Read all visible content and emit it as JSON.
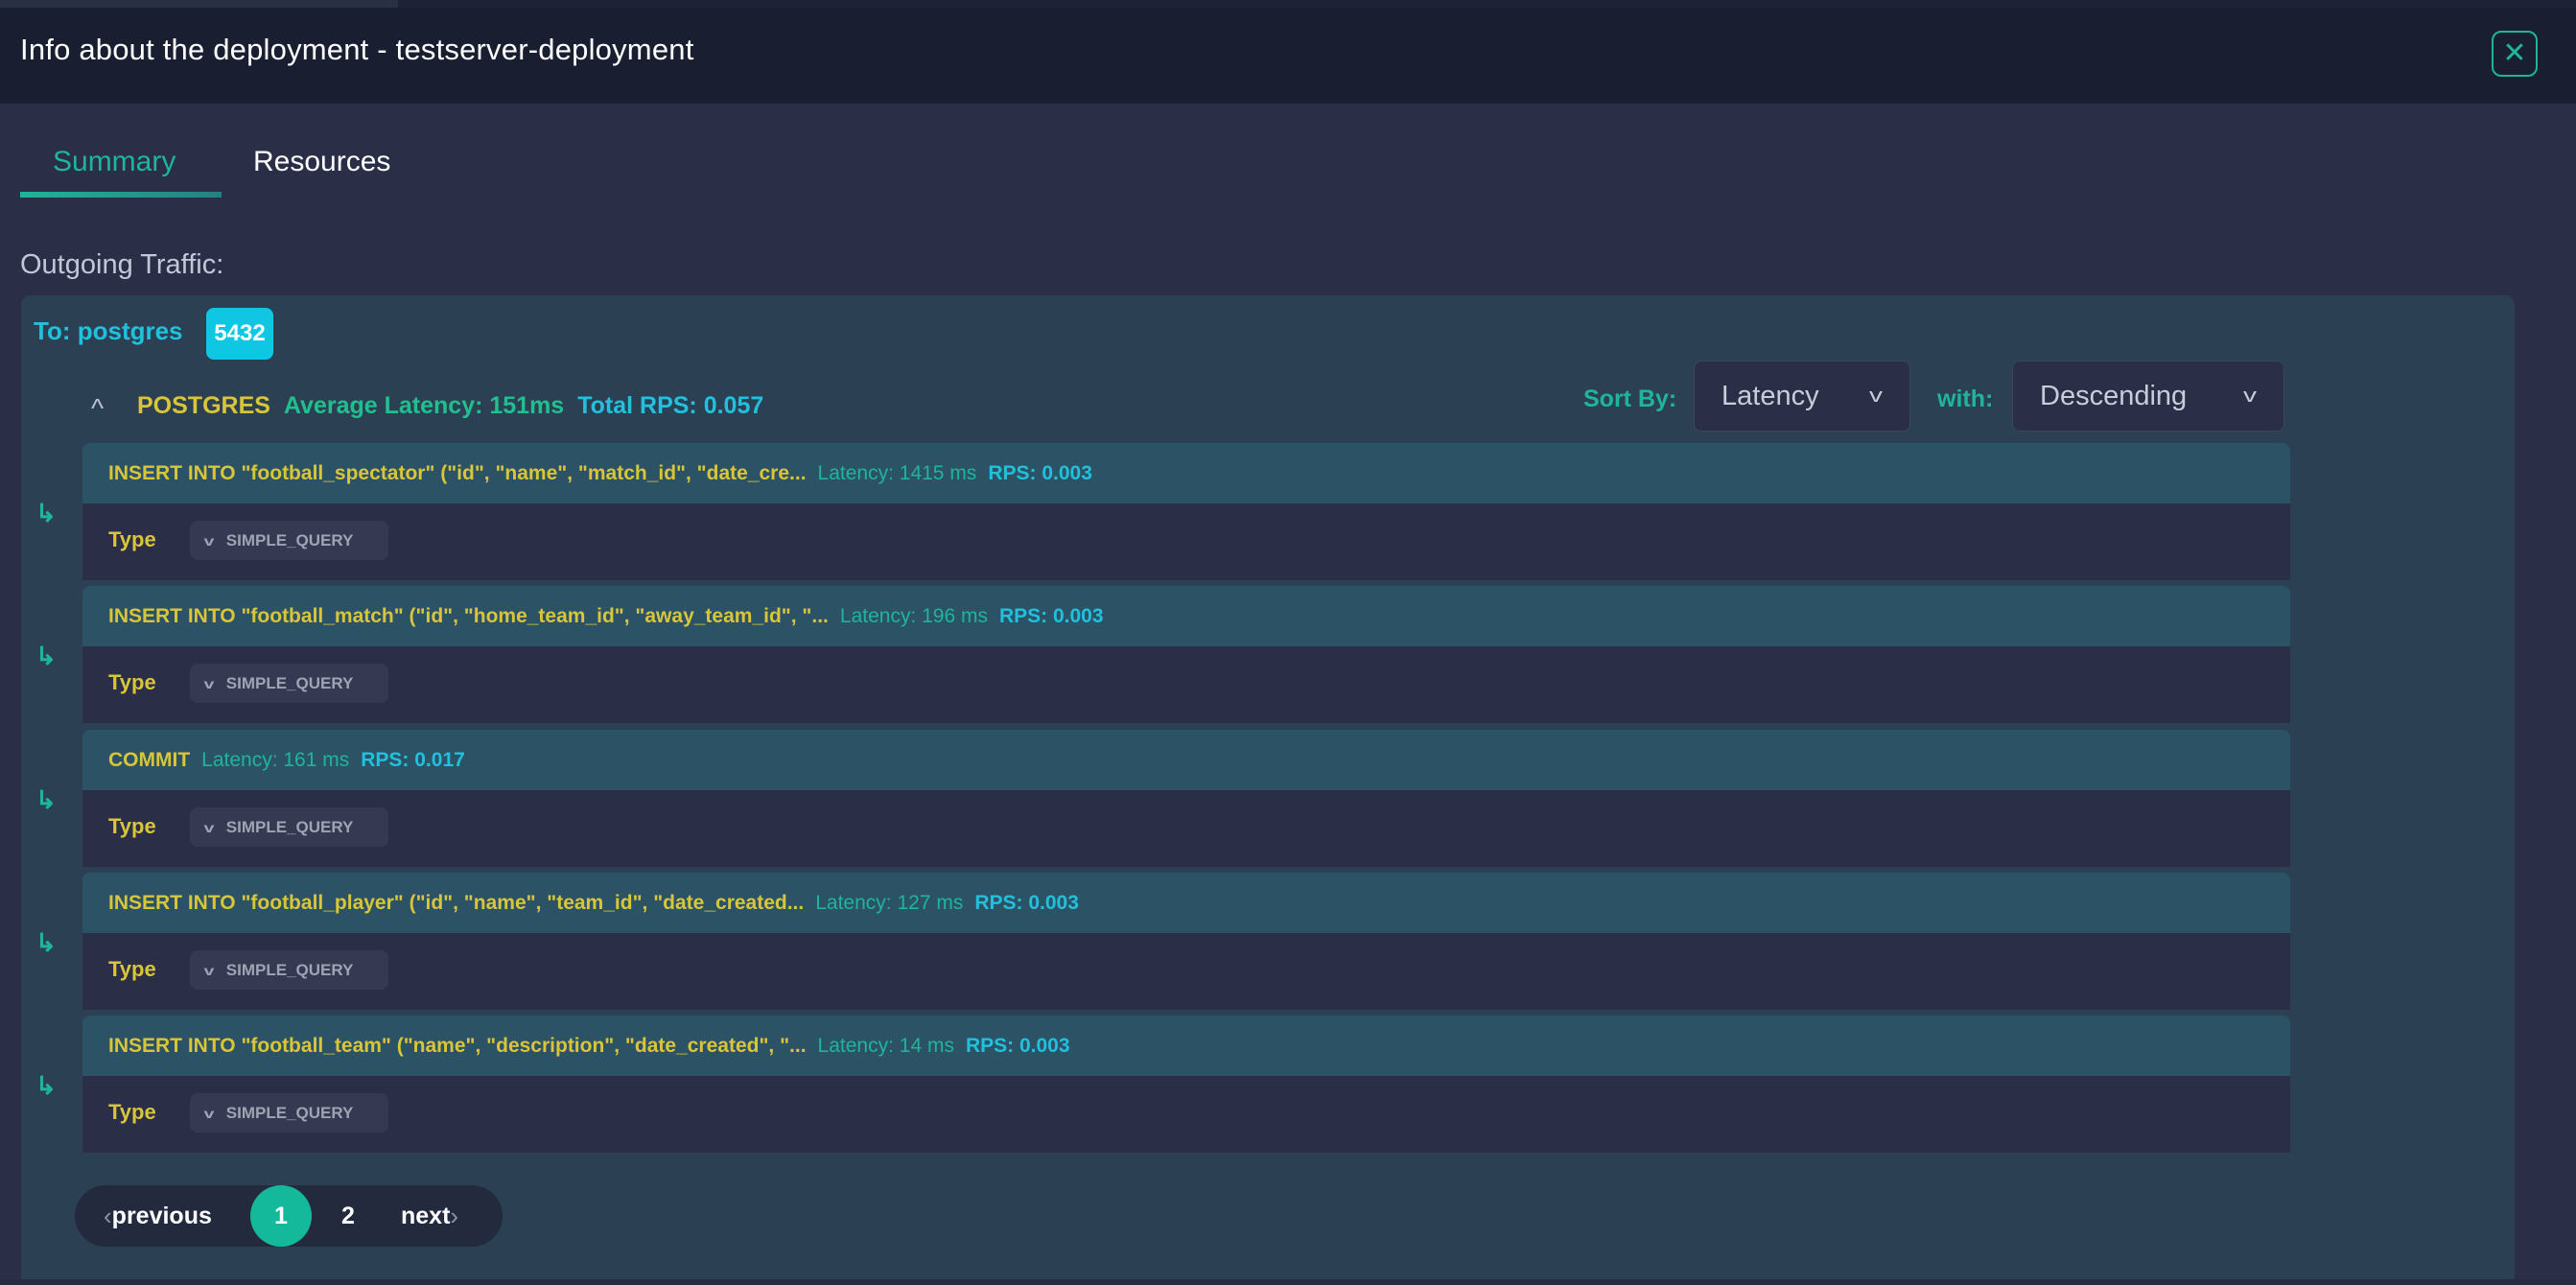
{
  "modal": {
    "title": "Info about the deployment - testserver-deployment",
    "close_icon": "close-icon"
  },
  "tabs": [
    {
      "label": "Summary",
      "active": true
    },
    {
      "label": "Resources",
      "active": false
    }
  ],
  "outgoing": {
    "section_label": "Outgoing Traffic:",
    "destination": "To: postgres",
    "port": "5432",
    "protocol": "POSTGRES",
    "average_latency": "Average Latency: 151ms",
    "total_rps": "Total RPS: 0.057",
    "collapse_icon": "chevron-up-icon",
    "sort": {
      "label": "Sort By:",
      "value": "Latency",
      "with_label": "with:",
      "order": "Descending"
    },
    "queries": [
      {
        "text": "INSERT INTO \"football_spectator\" (\"id\", \"name\", \"match_id\", \"date_cre...",
        "latency": "Latency: 1415 ms",
        "rps": "RPS: 0.003",
        "type_label": "Type",
        "type": "SIMPLE_QUERY"
      },
      {
        "text": "INSERT INTO \"football_match\" (\"id\", \"home_team_id\", \"away_team_id\", \"...",
        "latency": "Latency: 196 ms",
        "rps": "RPS: 0.003",
        "type_label": "Type",
        "type": "SIMPLE_QUERY"
      },
      {
        "text": "COMMIT",
        "latency": "Latency: 161 ms",
        "rps": "RPS: 0.017",
        "type_label": "Type",
        "type": "SIMPLE_QUERY"
      },
      {
        "text": "INSERT INTO \"football_player\" (\"id\", \"name\", \"team_id\", \"date_created...",
        "latency": "Latency: 127 ms",
        "rps": "RPS: 0.003",
        "type_label": "Type",
        "type": "SIMPLE_QUERY"
      },
      {
        "text": "INSERT INTO \"football_team\" (\"name\", \"description\", \"date_created\", \"...",
        "latency": "Latency: 14 ms",
        "rps": "RPS: 0.003",
        "type_label": "Type",
        "type": "SIMPLE_QUERY"
      }
    ]
  },
  "pagination": {
    "previous": "previous",
    "pages": [
      "1",
      "2"
    ],
    "current": "1",
    "next": "next"
  },
  "colors": {
    "accent": "#1fb59a",
    "query_text": "#d8c53a",
    "rps": "#21c0dd",
    "port_badge": "#0fc7e3"
  }
}
